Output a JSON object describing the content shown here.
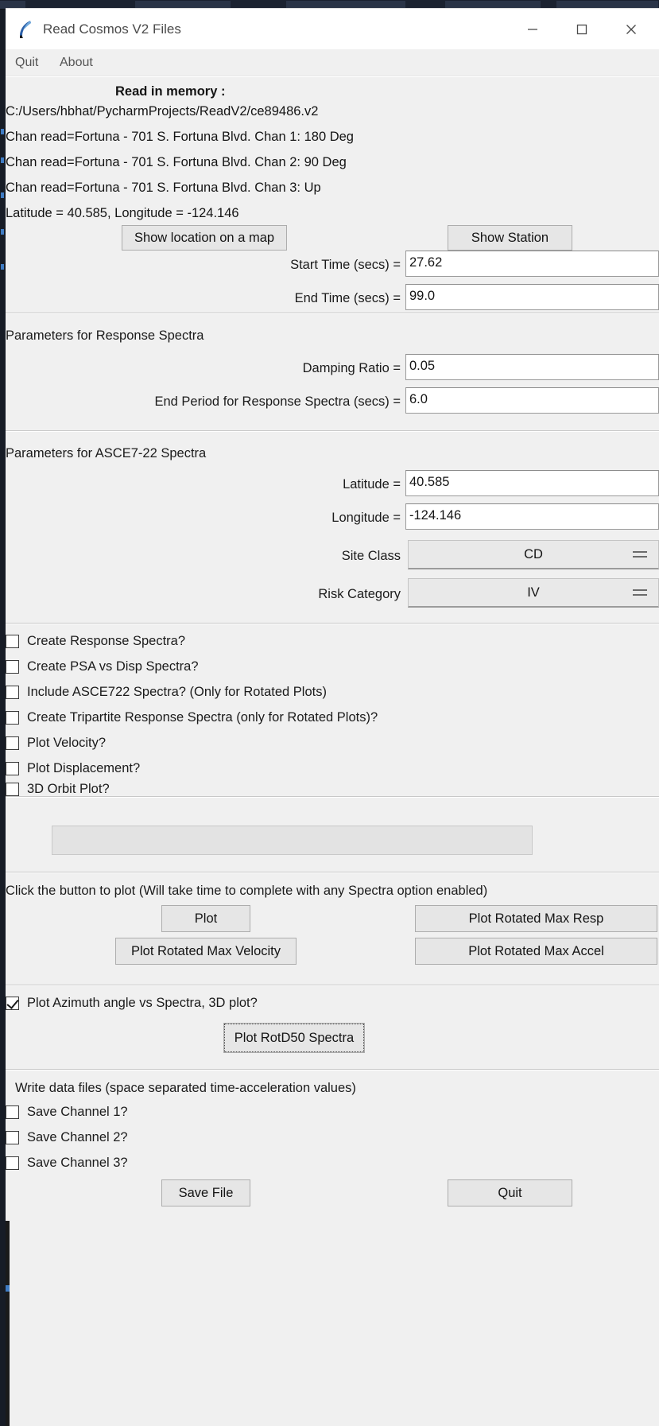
{
  "window": {
    "title": "Read Cosmos V2 Files",
    "icon": "feather-icon",
    "controls": {
      "minimize": "minimize-icon",
      "maximize": "maximize-icon",
      "close": "close-icon"
    }
  },
  "menu": {
    "items": [
      {
        "label": "Quit"
      },
      {
        "label": "About"
      }
    ]
  },
  "info": {
    "heading": "Read in memory :",
    "file_path": "C:/Users/hbhat/PycharmProjects/ReadV2/ce89486.v2",
    "channels": [
      "Chan read=Fortuna - 701 S. Fortuna Blvd.   Chan  1: 180 Deg",
      "Chan read=Fortuna - 701 S. Fortuna Blvd.   Chan  2:  90 Deg",
      "Chan read=Fortuna - 701 S. Fortuna Blvd.   Chan  3:  Up"
    ],
    "coords": "Latitude = 40.585, Longitude = -124.146"
  },
  "location_buttons": {
    "show_map": "Show location on a map",
    "show_station": "Show Station"
  },
  "time_params": {
    "start_label": "Start Time (secs) =",
    "start_value": "27.62",
    "end_label": "End Time (secs) =",
    "end_value": "99.0"
  },
  "response_spectra": {
    "title": "Parameters for Response Spectra",
    "damping_label": "Damping Ratio =",
    "damping_value": "0.05",
    "end_period_label": "End Period for Response Spectra (secs) =",
    "end_period_value": "6.0"
  },
  "asce": {
    "title": "Parameters for ASCE7-22 Spectra",
    "latitude_label": "Latitude =",
    "latitude_value": "40.585",
    "longitude_label": "Longitude =",
    "longitude_value": "-124.146",
    "site_class_label": "Site Class",
    "site_class_value": "CD",
    "risk_category_label": "Risk Category",
    "risk_category_value": "IV"
  },
  "options": [
    {
      "label": "Create Response Spectra?",
      "checked": false
    },
    {
      "label": "Create PSA vs Disp Spectra?",
      "checked": false
    },
    {
      "label": "Include ASCE722 Spectra? (Only for Rotated Plots)",
      "checked": false
    },
    {
      "label": "Create Tripartite Response Spectra (only for Rotated Plots)?",
      "checked": false
    },
    {
      "label": "Plot Velocity?",
      "checked": false
    },
    {
      "label": "Plot Displacement?",
      "checked": false
    },
    {
      "label": "3D Orbit Plot?",
      "checked": false
    }
  ],
  "progress": {
    "value": 0
  },
  "plot_section": {
    "hint": "Click the button to plot (Will take time to complete with any Spectra option enabled)",
    "plot": "Plot",
    "rotated_max_resp": "Plot Rotated Max Resp",
    "rotated_max_velocity": "Plot Rotated Max Velocity",
    "rotated_max_accel": "Plot Rotated Max Accel"
  },
  "azimuth_section": {
    "checkbox_label": "Plot Azimuth angle vs Spectra, 3D plot?",
    "checkbox_checked": true,
    "button": "Plot RotD50 Spectra"
  },
  "save_section": {
    "heading": "Write data files (space separated time-acceleration values)",
    "channels": [
      {
        "label": "Save Channel 1?",
        "checked": false
      },
      {
        "label": "Save Channel 2?",
        "checked": false
      },
      {
        "label": "Save Channel 3?",
        "checked": false
      }
    ],
    "save_button": "Save File",
    "quit_button": "Quit"
  },
  "colors": {
    "window_bg": "#f0f0f0",
    "titlebar_bg": "#ffffff",
    "field_bg": "#ffffff",
    "button_bg": "#e6e6e6",
    "text": "#141414"
  }
}
